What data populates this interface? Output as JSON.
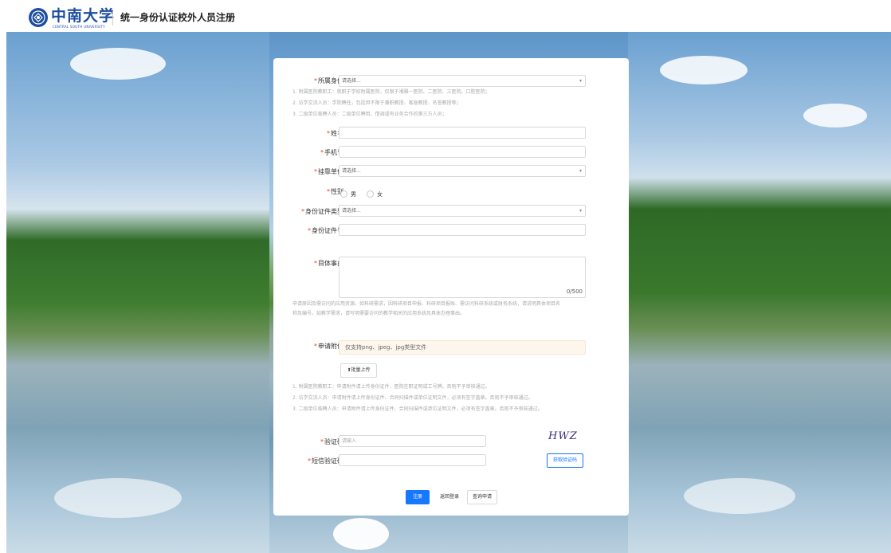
{
  "header": {
    "logo_cn": "中南大学",
    "logo_en": "CENTRAL SOUTH UNIVERSITY",
    "title": "统一身份认证校外人员注册"
  },
  "form": {
    "identity": {
      "label": "所属身份",
      "placeholder": "请选择...",
      "hints": [
        "1. 附属医院教职工：就职于学校附属医院，仅限于湘雅一医院、二医院、三医院、口腔医院；",
        "2. 访学交流人员：学院聘任，包括但不限于兼职教授、客座教授、名誉教授等；",
        "3. 二级单位临聘人员：二级单位聘用，借调或有业务合作的第三方人员；"
      ]
    },
    "name": {
      "label": "姓名"
    },
    "phone": {
      "label": "手机号"
    },
    "unit": {
      "label": "挂靠单位",
      "placeholder": "请选择..."
    },
    "gender": {
      "label": "性别",
      "options": [
        "男",
        "女"
      ]
    },
    "id_type": {
      "label": "身份证件类型",
      "placeholder": "请选择..."
    },
    "id_number": {
      "label": "身份证件号"
    },
    "reason": {
      "label": "目体事由",
      "counter": "0/500",
      "hint": "申请原因及需访问的应用资源。如科研需求，因科研项目申报、科研项目报账、需访问科研系统或财务系统，请说明具体项目名称及编号。如教学需求，请写明需要访问的教学相关的应用系统及具体办理事由。"
    },
    "attachment": {
      "label": "申请附件",
      "box_text": "仅支持png、jpeg、jpg类型文件",
      "upload_button": "批量上传",
      "hints": [
        "1. 附属医院教职工：申请附件请上传身份证件、医院在职证明或工号牌。否则不予审核通过。",
        "2. 访学交流人员：申请附件请上传身份证件、合同扫描件或单位证明文件，必须有签字盖章。否则不予审核通过。",
        "3. 二级单位临聘人员：申请附件请上传身份证件、合同扫描件或单位证明文件，必须有签字盖章。否则不予审核通过。"
      ]
    },
    "captcha": {
      "label": "验证码",
      "placeholder": "请输入",
      "image_text": "HWZ"
    },
    "sms": {
      "label": "短信验证码",
      "button": "获取验证码"
    }
  },
  "actions": {
    "register": "注册",
    "back_login": "返回登录",
    "query": "查询申请"
  },
  "colors": {
    "primary": "#1677ff",
    "required": "#f04134",
    "brand": "#1d4ea0"
  }
}
